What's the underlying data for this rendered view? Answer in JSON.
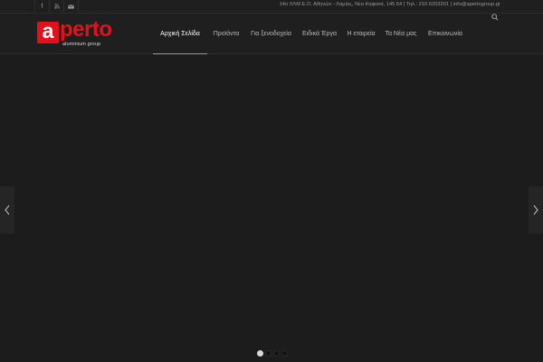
{
  "topbar": {
    "social": [
      {
        "name": "facebook",
        "glyph": "f"
      },
      {
        "name": "rss",
        "glyph": "⟩"
      },
      {
        "name": "mail",
        "glyph": "✉"
      }
    ],
    "contact": "14ο ΧΛΜ Ε.Ο. Αθηνών - Λαμίας, Νέα Κηφισιά, 145 64 | Τηλ.: 210 6203201 | info@apertogroup.gr"
  },
  "logo": {
    "letter": "a",
    "word": "perto",
    "sub": "aluminium group",
    "brand_color": "#e3111b"
  },
  "nav": {
    "items": [
      {
        "label": "Αρχική Σελίδα",
        "active": true
      },
      {
        "label": "Προϊόντα",
        "active": false
      },
      {
        "label": "Για ξενοδοχεία",
        "active": false
      },
      {
        "label": "Ειδικά Έργα",
        "active": false
      },
      {
        "label": "Η εταιρεία",
        "active": false
      },
      {
        "label": "Τα Νέα μας",
        "active": false
      },
      {
        "label": "Επικοινωνία",
        "active": false
      }
    ],
    "search_icon": "search-icon"
  },
  "slider": {
    "slides_count": 4,
    "active_index": 0
  }
}
